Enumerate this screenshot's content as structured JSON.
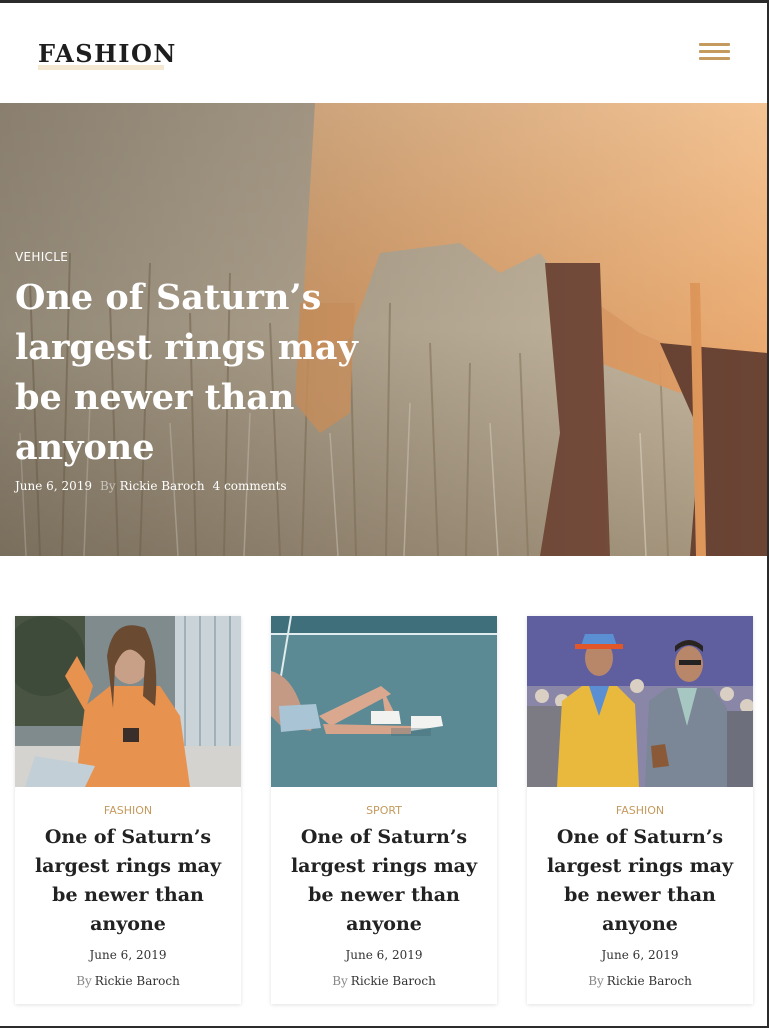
{
  "brand": {
    "logo": "FASHION",
    "accent": "#c49a5e"
  },
  "header": {
    "menu_icon": "hamburger-menu-icon"
  },
  "hero": {
    "category": "VEHICLE",
    "title": "One of Saturn’s largest rings may be newer than anyone",
    "date": "June 6, 2019",
    "by": "By",
    "author": "Rickie Baroch",
    "comments": "4 comments"
  },
  "cards": [
    {
      "category": "FASHION",
      "title": "One of Saturn’s largest rings may be newer than anyone",
      "date": "June 6, 2019",
      "by": "By",
      "author": "Rickie Baroch"
    },
    {
      "category": "SPORT",
      "title": "One of Saturn’s largest rings may be newer than anyone",
      "date": "June 6, 2019",
      "by": "By",
      "author": "Rickie Baroch"
    },
    {
      "category": "FASHION",
      "title": "One of Saturn’s largest rings may be newer than anyone",
      "date": "June 6, 2019",
      "by": "By",
      "author": "Rickie Baroch"
    }
  ]
}
